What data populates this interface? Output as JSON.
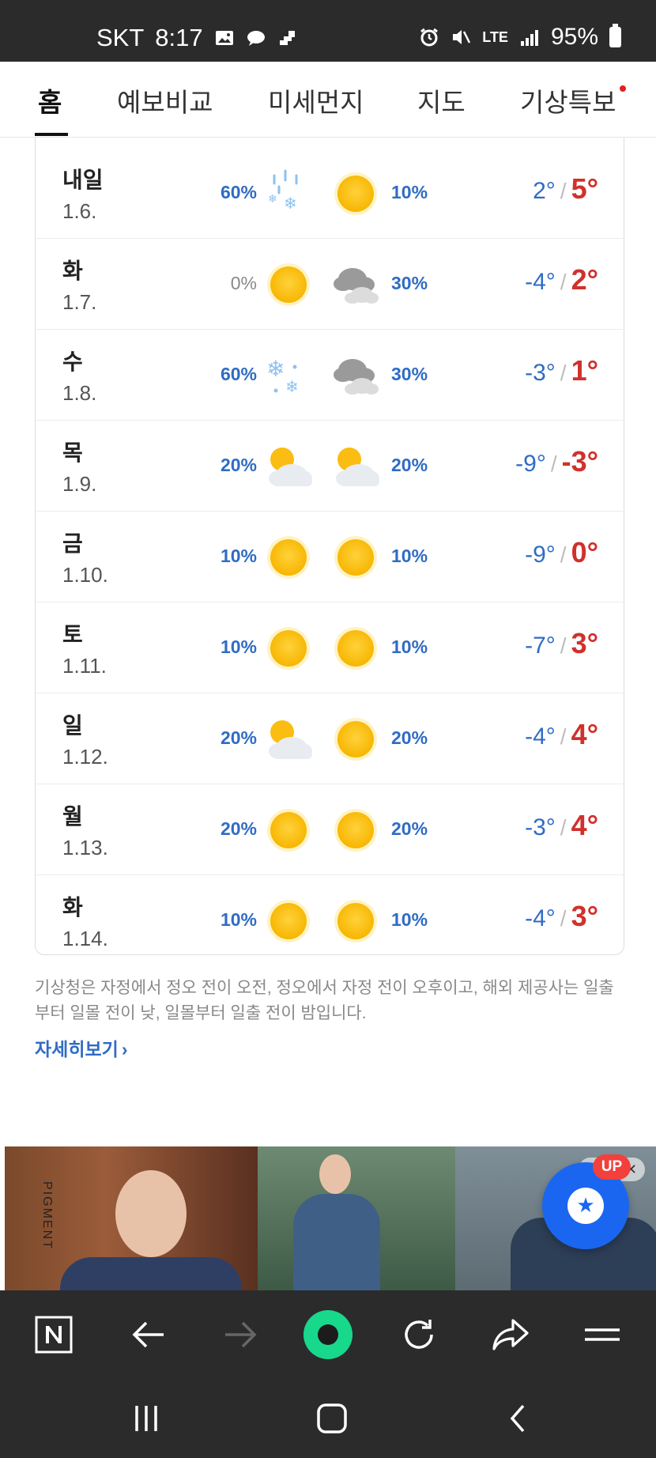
{
  "status_bar": {
    "carrier": "SKT",
    "time": "8:17",
    "network": "LTE",
    "battery": "95%"
  },
  "tabs": [
    {
      "label": "홈",
      "active": true
    },
    {
      "label": "예보비교",
      "active": false
    },
    {
      "label": "미세먼지",
      "active": false
    },
    {
      "label": "지도",
      "active": false
    },
    {
      "label": "기상특보",
      "active": false,
      "has_dot": true
    }
  ],
  "forecast": [
    {
      "day": "내일",
      "date": "1.6.",
      "am_pct": "60%",
      "am_icon": "snow-rain-icon",
      "pm_pct": "10%",
      "pm_icon": "sun-icon",
      "min": "2°",
      "max": "5°"
    },
    {
      "day": "화",
      "date": "1.7.",
      "am_pct": "0%",
      "am_icon": "sun-icon",
      "pm_pct": "30%",
      "pm_icon": "cloudy-icon",
      "min": "-4°",
      "max": "2°"
    },
    {
      "day": "수",
      "date": "1.8.",
      "am_pct": "60%",
      "am_icon": "snow-icon",
      "pm_pct": "30%",
      "pm_icon": "cloudy-icon",
      "min": "-3°",
      "max": "1°"
    },
    {
      "day": "목",
      "date": "1.9.",
      "am_pct": "20%",
      "am_icon": "partly-cloudy-icon",
      "pm_pct": "20%",
      "pm_icon": "partly-cloudy-icon",
      "min": "-9°",
      "max": "-3°"
    },
    {
      "day": "금",
      "date": "1.10.",
      "am_pct": "10%",
      "am_icon": "sun-icon",
      "pm_pct": "10%",
      "pm_icon": "sun-icon",
      "min": "-9°",
      "max": "0°"
    },
    {
      "day": "토",
      "date": "1.11.",
      "am_pct": "10%",
      "am_icon": "sun-icon",
      "pm_pct": "10%",
      "pm_icon": "sun-icon",
      "min": "-7°",
      "max": "3°"
    },
    {
      "day": "일",
      "date": "1.12.",
      "am_pct": "20%",
      "am_icon": "partly-cloudy-icon",
      "pm_pct": "20%",
      "pm_icon": "sun-icon",
      "min": "-4°",
      "max": "4°"
    },
    {
      "day": "월",
      "date": "1.13.",
      "am_pct": "20%",
      "am_icon": "sun-icon",
      "pm_pct": "20%",
      "pm_icon": "sun-icon",
      "min": "-3°",
      "max": "4°"
    },
    {
      "day": "화",
      "date": "1.14.",
      "am_pct": "10%",
      "am_icon": "sun-icon",
      "pm_pct": "10%",
      "pm_icon": "sun-icon",
      "min": "-4°",
      "max": "3°"
    }
  ],
  "note": {
    "text": "기상청은 자정에서 정오 전이 오전, 정오에서 자정 전이 오후이고, 해외 제공사는 일출부터 일몰 전이 낮, 일몰부터 일출 전이 밤입니다.",
    "more_label": "자세히보기"
  },
  "ad": {
    "brand": "PIGMENT",
    "close": "✕"
  },
  "fab": {
    "badge": "UP"
  },
  "colors": {
    "rain_pct": "#2f6cc4",
    "min_temp": "#2f6cc4",
    "max_temp": "#d0312d",
    "fab": "#1a66f0",
    "dark_bar": "#2b2b2b"
  }
}
